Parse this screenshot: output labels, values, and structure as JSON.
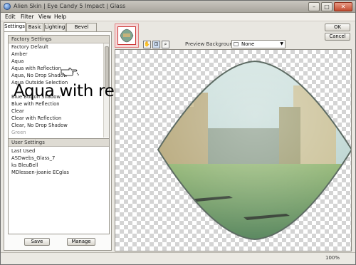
{
  "window": {
    "title": "Alien Skin | Eye Candy 5 Impact | Glass"
  },
  "menu": [
    "Edit",
    "Filter",
    "View",
    "Help"
  ],
  "tabs": [
    "Settings",
    "Basic",
    "Lighting",
    "Bevel Profile"
  ],
  "factory": {
    "header": "Factory Settings",
    "items": [
      "Factory Default",
      "Amber",
      "Aqua",
      "Aqua with Reflection",
      "Aqua, No Drop Shadow",
      "Aqua Outside Selection",
      "Blue Button Shadow",
      "Blue with Reflection",
      "Clear",
      "Clear with Reflection",
      "Clear, No Drop Shadow",
      "Green"
    ]
  },
  "user": {
    "header": "User Settings",
    "items": [
      "Last Used",
      "ASDwebs_Glass_7",
      "ks BleuBell",
      "MDlessen-joanie ECglas"
    ]
  },
  "buttons": {
    "save": "Save",
    "manage": "Manage",
    "ok": "OK",
    "cancel": "Cancel"
  },
  "overlay_caption": "Aqua with reflection",
  "preview": {
    "label": "Preview Background:",
    "selected": "None"
  },
  "status": {
    "zoom": "100%"
  },
  "colors": {
    "title_bg": "#bcb9b1",
    "panel_bg": "#e9e7e1",
    "checker": "#d4d4d4"
  }
}
